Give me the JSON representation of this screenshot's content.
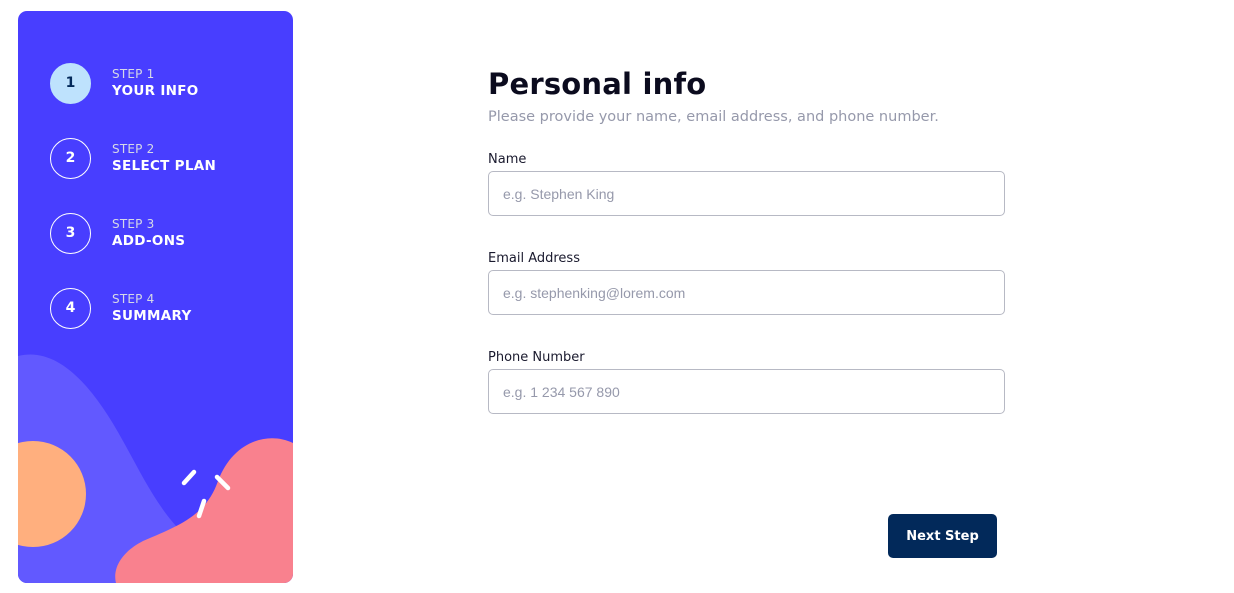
{
  "sidebar": {
    "steps": [
      {
        "number": "1",
        "step_label": "STEP 1",
        "title": "YOUR INFO",
        "active": true
      },
      {
        "number": "2",
        "step_label": "STEP 2",
        "title": "SELECT PLAN",
        "active": false
      },
      {
        "number": "3",
        "step_label": "STEP 3",
        "title": "ADD-ONS",
        "active": false
      },
      {
        "number": "4",
        "step_label": "STEP 4",
        "title": "SUMMARY",
        "active": false
      }
    ]
  },
  "main": {
    "title": "Personal info",
    "subtitle": "Please provide your name, email address, and phone number.",
    "fields": {
      "name": {
        "label": "Name",
        "placeholder": "e.g. Stephen King",
        "value": ""
      },
      "email": {
        "label": "Email Address",
        "placeholder": "e.g. stephenking@lorem.com",
        "value": ""
      },
      "phone": {
        "label": "Phone Number",
        "placeholder": "e.g. 1 234 567 890",
        "value": ""
      }
    },
    "next_button_label": "Next Step"
  },
  "colors": {
    "sidebar_bg": "#483eff",
    "active_step": "#bee2fd",
    "primary_dark": "#02295a",
    "blob_orange": "#ffaf7e",
    "blob_pink": "#f9818e",
    "blob_purple": "#6259ff",
    "muted_text": "#9699ab",
    "border": "#d6d9e6"
  }
}
